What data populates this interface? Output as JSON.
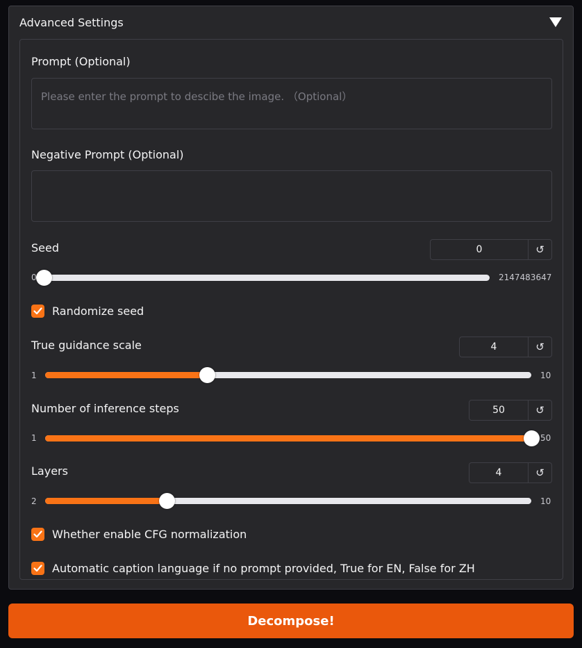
{
  "accordion": {
    "title": "Advanced Settings",
    "toggle_icon": "triangle-down-icon"
  },
  "prompt": {
    "label": "Prompt (Optional)",
    "placeholder": "Please enter the prompt to descibe the image. （Optional）",
    "value": ""
  },
  "negative_prompt": {
    "label": "Negative Prompt (Optional)",
    "value": ""
  },
  "seed": {
    "label": "Seed",
    "value": "0",
    "min": "0",
    "max": "2147483647",
    "fraction": 0.0
  },
  "randomize_seed": {
    "label": "Randomize seed",
    "checked": true
  },
  "guidance": {
    "label": "True guidance scale",
    "value": "4",
    "min": "1",
    "max": "10",
    "fraction": 0.333
  },
  "steps": {
    "label": "Number of inference steps",
    "value": "50",
    "min": "1",
    "max": "50",
    "fraction": 1.0
  },
  "layers": {
    "label": "Layers",
    "value": "4",
    "min": "2",
    "max": "10",
    "fraction": 0.25
  },
  "cfg_norm": {
    "label": "Whether enable CFG normalization",
    "checked": true
  },
  "caption_lang": {
    "label": "Automatic caption language if no prompt provided, True for EN, False for ZH",
    "checked": true
  },
  "reset_icon": "↺",
  "decompose": {
    "label": "Decompose!"
  },
  "colors": {
    "accent": "#f97316",
    "button": "#ea580c",
    "panel": "#27272a",
    "border": "#3f3f46",
    "background": "#0b0b0f"
  }
}
